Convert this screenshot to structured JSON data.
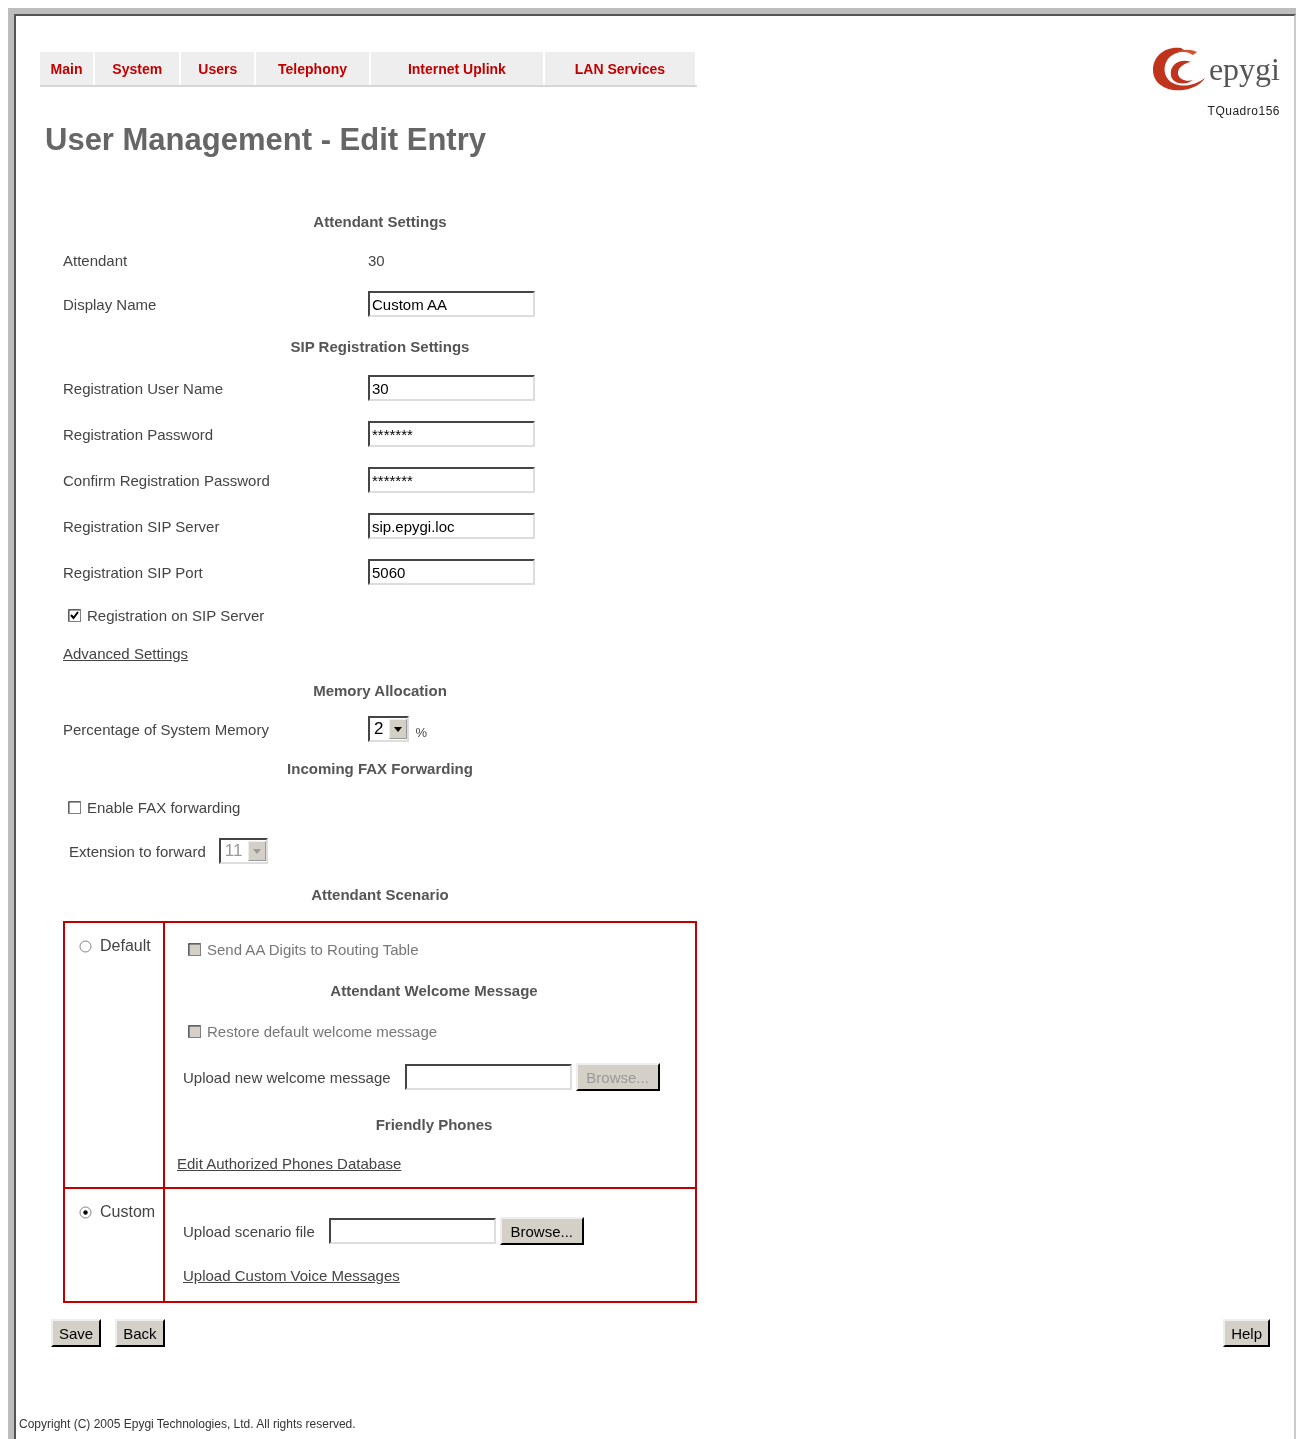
{
  "nav": {
    "tabs": [
      {
        "label": "Main"
      },
      {
        "label": "System"
      },
      {
        "label": "Users"
      },
      {
        "label": "Telephony"
      },
      {
        "label": "Internet Uplink"
      },
      {
        "label": "LAN Services"
      }
    ]
  },
  "brand": {
    "logo_text": "epygi",
    "model": "TQuadro156"
  },
  "title": "User Management - Edit Entry",
  "form": {
    "rows": [
      {
        "kind": "heading",
        "text": "Attendant Settings"
      },
      {
        "kind": "value",
        "label": "Attendant",
        "value": "30"
      },
      {
        "kind": "input",
        "label": "Display Name",
        "value": "Custom AA"
      },
      {
        "kind": "heading",
        "text": "SIP Registration Settings"
      },
      {
        "kind": "input",
        "label": "Registration User Name",
        "value": "30"
      },
      {
        "kind": "input",
        "label": "Registration Password",
        "value": "*******"
      },
      {
        "kind": "input",
        "label": "Confirm Registration Password",
        "value": "*******"
      },
      {
        "kind": "input",
        "label": "Registration SIP Server",
        "value": "sip.epygi.loc"
      },
      {
        "kind": "input",
        "label": "Registration SIP Port",
        "value": "5060"
      },
      {
        "kind": "checkbox",
        "label": "Registration on SIP Server",
        "checked": true,
        "disabled": false
      },
      {
        "kind": "link",
        "text": "Advanced Settings"
      },
      {
        "kind": "heading",
        "text": "Memory Allocation"
      },
      {
        "kind": "select",
        "label": "Percentage of System Memory",
        "value": "2",
        "unit": "%",
        "disabled": false
      },
      {
        "kind": "heading",
        "text": "Incoming FAX Forwarding"
      },
      {
        "kind": "checkbox",
        "label": "Enable FAX forwarding",
        "checked": false,
        "disabled": false
      },
      {
        "kind": "inline_select",
        "label": "Extension to forward",
        "value": "11",
        "disabled": true
      },
      {
        "kind": "heading",
        "text": "Attendant Scenario"
      }
    ]
  },
  "scenario": {
    "options": [
      {
        "label": "Default",
        "selected": false,
        "items": [
          {
            "kind": "checkbox",
            "label": "Send AA Digits to Routing Table",
            "checked": false,
            "disabled": true
          },
          {
            "kind": "heading",
            "text": "Attendant Welcome Message"
          },
          {
            "kind": "checkbox",
            "label": "Restore default welcome message",
            "checked": false,
            "disabled": true
          },
          {
            "kind": "file",
            "label": "Upload new welcome message",
            "button": "Browse...",
            "disabled": true
          },
          {
            "kind": "heading",
            "text": "Friendly Phones"
          },
          {
            "kind": "link",
            "text": "Edit Authorized Phones Database"
          }
        ]
      },
      {
        "label": "Custom",
        "selected": true,
        "items": [
          {
            "kind": "file",
            "label": "Upload scenario file",
            "button": "Browse...",
            "disabled": false
          },
          {
            "kind": "link",
            "text": "Upload Custom Voice Messages"
          }
        ]
      }
    ]
  },
  "buttons": [
    "Save",
    "Back"
  ],
  "help": "Help",
  "copyright": "Copyright (C) 2005 Epygi Technologies, Ltd. All rights reserved."
}
